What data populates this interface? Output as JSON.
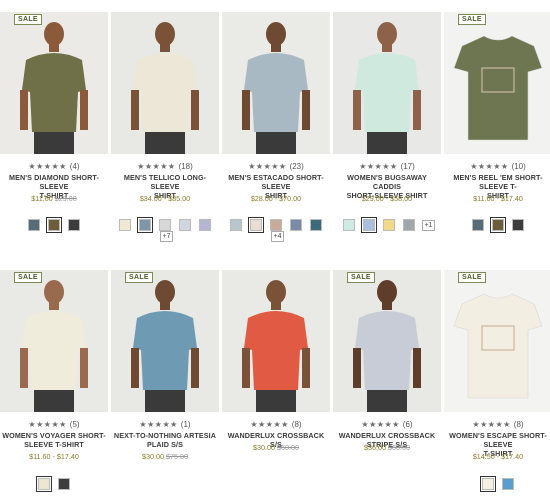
{
  "products": [
    {
      "sale_badge": "SALE",
      "stars": "★★★★★",
      "reviews": "(4)",
      "name_line1": "MEN'S DIAMOND SHORT-SLEEVE",
      "name_line2": "T-SHIRT",
      "price": "$11.60",
      "price_old": "$29.00",
      "swatches": [
        "#5a6b78",
        "#6b5d3a",
        "#3d3d3d"
      ],
      "more": "",
      "shirt": "#6f7048",
      "bg": "#ebeae6",
      "skin": "#8a5a3a"
    },
    {
      "sale_badge": "",
      "stars": "★★★★★",
      "reviews": "(18)",
      "name_line1": "MEN'S TELLICO LONG-SLEEVE",
      "name_line2": "SHIRT",
      "price": "$34.00 - $85.00",
      "price_old": "",
      "swatches": [
        "#efe8d4",
        "#7f95a8",
        "#d8d8d8",
        "#cfd6e0",
        "#b4b6d4"
      ],
      "more": "+7",
      "shirt": "#ece7d6",
      "bg": "#e8e8e5",
      "skin": "#7a5238"
    },
    {
      "sale_badge": "",
      "stars": "★★★★★",
      "reviews": "(23)",
      "name_line1": "MEN'S ESTACADO SHORT-SLEEVE",
      "name_line2": "SHIRT",
      "price": "$28.00 - $70.00",
      "price_old": "",
      "swatches": [
        "#b7c6cf",
        "#e9ded6",
        "#c9a99a",
        "#7a8aa8",
        "#3d6a7a"
      ],
      "more": "+4",
      "shirt": "#a9b9c4",
      "bg": "#eaeae7",
      "skin": "#6e4a33"
    },
    {
      "sale_badge": "",
      "stars": "★★★★★",
      "reviews": "(17)",
      "name_line1": "WOMEN'S BUGSAWAY CADDIS",
      "name_line2": "SHORT-SLEEVE SHIRT",
      "price": "$29.00 - $58.00",
      "price_old": "",
      "swatches": [
        "#cfeae3",
        "#a9bfe0",
        "#f2d98a",
        "#a0a6ac"
      ],
      "more": "+1",
      "shirt": "#cfe9df",
      "bg": "#e8e8e6",
      "skin": "#8e6248"
    },
    {
      "sale_badge": "SALE",
      "stars": "★★★★★",
      "reviews": "(10)",
      "name_line1": "MEN'S REEL 'EM SHORT-SLEEVE T-",
      "name_line2": "SHIRT",
      "price": "$11.60 - $17.40",
      "price_old": "",
      "swatches": [
        "#5a6b78",
        "#6b5d3a",
        "#3d3d3d"
      ],
      "more": "",
      "shirt": "#6e7551",
      "bg": "#f2f2f0",
      "skin": "none"
    },
    {
      "sale_badge": "SALE",
      "stars": "★★★★★",
      "reviews": "(5)",
      "name_line1": "WOMEN'S VOYAGER SHORT-",
      "name_line2": "SLEEVE T-SHIRT",
      "price": "$11.60 - $17.40",
      "price_old": "",
      "swatches": [
        "#ebe7d2",
        "#3d3d3d"
      ],
      "more": "",
      "shirt": "#efecdb",
      "bg": "#e9e9e6",
      "skin": "#9a6a4e"
    },
    {
      "sale_badge": "SALE",
      "stars": "★★★★★",
      "reviews": "(1)",
      "name_line1": "NEXT-TO-NOTHING ARTESIA",
      "name_line2": "PLAID S/S",
      "price": "$30.00",
      "price_old": "$75.00",
      "swatches": [],
      "more": "",
      "shirt": "#6e9bb3",
      "bg": "#e8e8e5",
      "skin": "#6e4a33"
    },
    {
      "sale_badge": "",
      "stars": "★★★★★",
      "reviews": "(8)",
      "name_line1": "WANDERLUX CROSSBACK S/S",
      "name_line2": "",
      "price": "$30.00",
      "price_old": "$60.00",
      "swatches": [],
      "more": "",
      "shirt": "#e05a44",
      "bg": "#e9e9e6",
      "skin": "#7a5238"
    },
    {
      "sale_badge": "SALE",
      "stars": "★★★★★",
      "reviews": "(6)",
      "name_line1": "WANDERLUX CROSSBACK STRIPE S/S",
      "name_line2": "",
      "price": "$36.00",
      "price_old": "$60.00",
      "swatches": [],
      "more": "",
      "shirt": "#c7ccd6",
      "bg": "#e8e8e5",
      "skin": "#5e3d2a"
    },
    {
      "sale_badge": "SALE",
      "stars": "★★★★★",
      "reviews": "(8)",
      "name_line1": "WOMEN'S ESCAPE SHORT-SLEEVE",
      "name_line2": "T-SHIRT",
      "price": "$14.50 - $17.40",
      "price_old": "",
      "swatches": [
        "#f3efe2",
        "#5a9ecf"
      ],
      "more": "",
      "shirt": "#f3eee2",
      "bg": "#f3f3f1",
      "skin": "none"
    }
  ]
}
